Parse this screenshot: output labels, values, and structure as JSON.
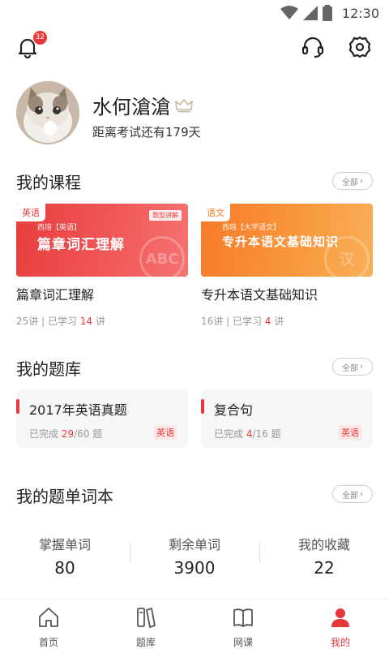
{
  "status_bar": {
    "time": "12:30"
  },
  "header": {
    "notification_count": "32"
  },
  "profile": {
    "name": "水何滄滄",
    "subtitle": "距离考试还有179天"
  },
  "courses": {
    "title": "我的课程",
    "all_label": "全部",
    "items": [
      {
        "tag": "英语",
        "cover_small": "西培【英语】",
        "cover_chip": "题型讲解",
        "cover_title": "篇章词汇理解",
        "watermark": "ABC",
        "title": "篇章词汇理解",
        "lessons": "25讲",
        "learned_prefix": "已学习",
        "learned": "14",
        "learned_suffix": "讲"
      },
      {
        "tag": "语文",
        "cover_small": "西培【大学语文】",
        "cover_title": "专升本语文基础知识",
        "watermark": "汉",
        "title": "专升本语文基础知识",
        "lessons": "16讲",
        "learned_prefix": "已学习",
        "learned": "4",
        "learned_suffix": "讲"
      }
    ]
  },
  "question_bank": {
    "title": "我的题库",
    "all_label": "全部",
    "items": [
      {
        "title": "2017年英语真题",
        "done_prefix": "已完成",
        "done": "29",
        "total": "/60 题",
        "tag": "英语"
      },
      {
        "title": "复合句",
        "done_prefix": "已完成",
        "done": "4",
        "total": "/16 题",
        "tag": "英语"
      }
    ]
  },
  "vocab": {
    "title": "我的题单词本",
    "all_label": "全部",
    "stats": [
      {
        "label": "掌握单词",
        "value": "80"
      },
      {
        "label": "剩余单词",
        "value": "3900"
      },
      {
        "label": "我的收藏",
        "value": "22"
      }
    ]
  },
  "tabs": [
    {
      "label": "首页"
    },
    {
      "label": "题库"
    },
    {
      "label": "网课"
    },
    {
      "label": "我的"
    }
  ],
  "colors": {
    "accent": "#e8373a",
    "orange": "#f07a1f"
  }
}
